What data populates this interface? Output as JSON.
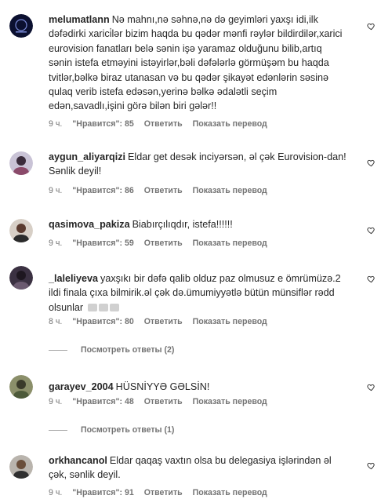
{
  "comments": [
    {
      "username": "melumatlann",
      "text": "Nə mahnı,nə səhnə,nə də geyimləri yaxşı idi,ilk dəfədirki xarici̇lər bizim haqda bu qədər mənfi rəylər bildirdilər,xarici eurovision fanatları belə sənin işə yaramaz olduğunu bilib,artıq sənin istefa etməyini istəyirlər,bəli dəfələrlə görmüşəm bu haqda tvitlər,bəlkə biraz utanasan və bu qədər şikayət edənlərin səsinə qulaq verib istefa edəsən,yerinə bəlkə ədalətli seçim edən,savadlı,işini görə bilən biri gələr!!",
      "time": "9 ч.",
      "likes": "\"Нравится\": 85",
      "reply": "Ответить",
      "translate": "Показать перевод"
    },
    {
      "username": "aygun_aliyarqizi",
      "text": "Eldar get desək inciyərsən, əl çək Eurovision-dan! Sənlik deyil!",
      "time": "9 ч.",
      "likes": "\"Нравится\": 86",
      "reply": "Ответить",
      "translate": "Показать перевод"
    },
    {
      "username": "qasimova_pakiza",
      "text": "Biabırçılıqdır, istefa!!!!!!",
      "time": "9 ч.",
      "likes": "\"Нравится\": 59",
      "reply": "Ответить",
      "translate": "Показать перевод"
    },
    {
      "username": "_laleliyeva",
      "text": "yaxşıkı bir dəfə qalib olduz paz olmusuz e ömrümüzə.2 ildi finala çıxa bilmirik.əl çək də.ümumiyyətlə bütün münsiflər rədd olsunlar",
      "time": "8 ч.",
      "likes": "\"Нравится\": 80",
      "reply": "Ответить",
      "translate": "Показать перевод",
      "view_replies": "Посмотреть ответы (2)"
    },
    {
      "username": "garayev_2004",
      "text": "HÜSNİYYƏ GƏLSİN!",
      "time": "9 ч.",
      "likes": "\"Нравится\": 48",
      "reply": "Ответить",
      "translate": "Показать перевод",
      "view_replies": "Посмотреть ответы (1)"
    },
    {
      "username": "orkhancanol",
      "text": "Eldar qaqaş vaxtın olsa bu delegasiya işlərindən əl çək, sənlik deyil.",
      "time": "9 ч.",
      "likes": "\"Нравится\": 91",
      "reply": "Ответить",
      "translate": "Показать перевод"
    }
  ],
  "icons": {
    "like": "heart-outline-icon",
    "emoji": "newspaper-emoji-icon"
  },
  "colors": {
    "text": "#262626",
    "secondary": "#737373",
    "divider": "#a8a8a8"
  }
}
